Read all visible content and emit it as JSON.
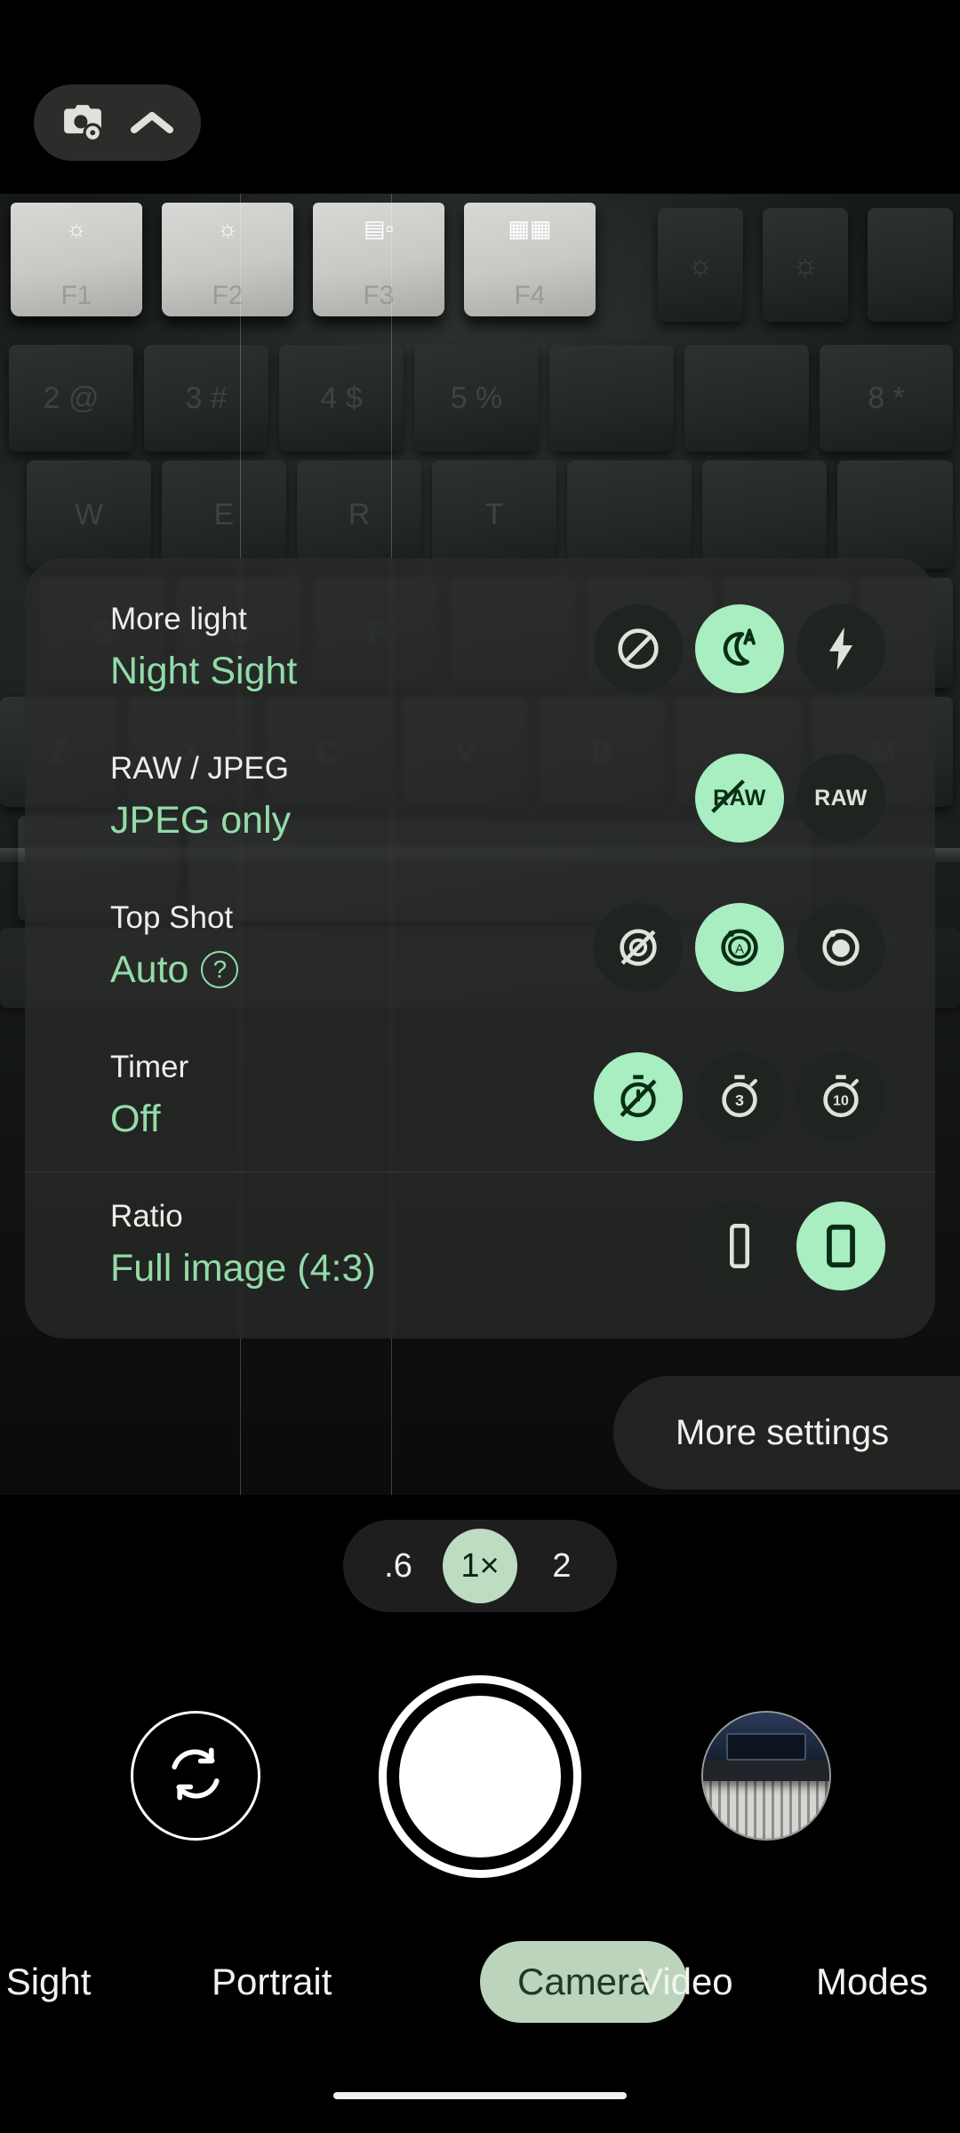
{
  "app": {
    "name": "Camera",
    "theme_accent": "#a8eec0",
    "value_text_color": "#93dba8"
  },
  "top_bar": {
    "quick_settings_label": "camera-settings",
    "icons": [
      "camera-settings-icon",
      "chevron-up-icon"
    ]
  },
  "settings_sheet": {
    "rows": [
      {
        "title": "More light",
        "value": "Night Sight",
        "has_help": false,
        "options": [
          {
            "name": "night-sight-off",
            "icon": "no-symbol-icon",
            "selected": false
          },
          {
            "name": "night-sight-auto",
            "icon": "moon-auto-icon",
            "selected": true
          },
          {
            "name": "flash-on",
            "icon": "flash-bolt-icon",
            "selected": false
          }
        ]
      },
      {
        "title": "RAW / JPEG",
        "value": "JPEG only",
        "has_help": false,
        "options": [
          {
            "name": "raw-off",
            "icon": "raw-slashed-icon",
            "label": "RAW",
            "selected": true
          },
          {
            "name": "raw-on",
            "icon": "raw-icon",
            "label": "RAW",
            "selected": false
          }
        ]
      },
      {
        "title": "Top Shot",
        "value": "Auto",
        "has_help": true,
        "help_label": "?",
        "options": [
          {
            "name": "top-shot-off",
            "icon": "top-shot-off-icon",
            "selected": false
          },
          {
            "name": "top-shot-auto",
            "icon": "top-shot-auto-icon",
            "selected": true
          },
          {
            "name": "top-shot-on",
            "icon": "top-shot-on-icon",
            "selected": false
          }
        ]
      },
      {
        "title": "Timer",
        "value": "Off",
        "has_help": false,
        "options": [
          {
            "name": "timer-off",
            "icon": "timer-off-icon",
            "selected": true
          },
          {
            "name": "timer-3s",
            "icon": "timer-3-icon",
            "label": "3",
            "selected": false
          },
          {
            "name": "timer-10s",
            "icon": "timer-10-icon",
            "label": "10",
            "selected": false
          }
        ]
      },
      {
        "title": "Ratio",
        "value": "Full image (4:3)",
        "has_help": false,
        "divided": true,
        "options": [
          {
            "name": "ratio-full-screen",
            "icon": "phone-tall-icon",
            "selected": false
          },
          {
            "name": "ratio-4-3",
            "icon": "phone-wide-icon",
            "selected": true
          }
        ]
      }
    ]
  },
  "more_settings": {
    "label": "More settings"
  },
  "zoom": {
    "levels": [
      {
        "label": ".6",
        "active": false
      },
      {
        "label": "1×",
        "active": true
      },
      {
        "label": "2",
        "active": false
      }
    ]
  },
  "capture": {
    "flip_camera_label": "flip-camera",
    "shutter_label": "shutter",
    "gallery_thumb_label": "gallery-thumbnail"
  },
  "modes": [
    {
      "label": "ht Sight",
      "active": false
    },
    {
      "label": "Portrait",
      "active": false
    },
    {
      "label": "Camera",
      "active": true
    },
    {
      "label": "Video",
      "active": false
    },
    {
      "label": "Modes",
      "active": false
    }
  ]
}
